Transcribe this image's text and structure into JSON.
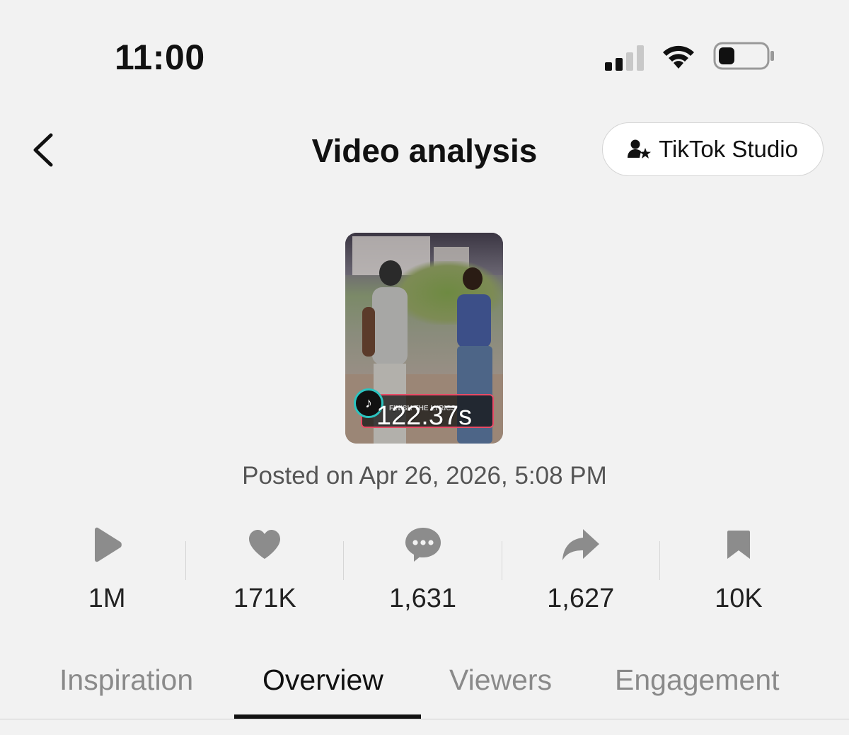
{
  "status_bar": {
    "time": "11:00",
    "signal_icon": "signal-icon",
    "wifi_icon": "wifi-icon",
    "battery_icon": "battery-icon"
  },
  "header": {
    "title": "Video analysis",
    "back_icon": "chevron-left-icon",
    "studio_button": {
      "label": "TikTok Studio",
      "icon": "user-star-icon"
    }
  },
  "video": {
    "duration": "122.37s",
    "overlay_text": "FINISH THE LYRICS",
    "posted": "Posted on Apr 26, 2026, 5:08 PM"
  },
  "stats": [
    {
      "icon": "play-icon",
      "value": "1M"
    },
    {
      "icon": "heart-icon",
      "value": "171K"
    },
    {
      "icon": "comment-icon",
      "value": "1,631"
    },
    {
      "icon": "share-icon",
      "value": "1,627"
    },
    {
      "icon": "bookmark-icon",
      "value": "10K"
    }
  ],
  "tabs": [
    {
      "label": "Inspiration",
      "active": false
    },
    {
      "label": "Overview",
      "active": true
    },
    {
      "label": "Viewers",
      "active": false
    },
    {
      "label": "Engagement",
      "active": false
    }
  ],
  "colors": {
    "background": "#f2f2f2",
    "icon_gray": "#8c8c8c",
    "text_dark": "#111111",
    "tab_inactive": "#8a8a8a",
    "overlay_accent": "#e94b66"
  }
}
